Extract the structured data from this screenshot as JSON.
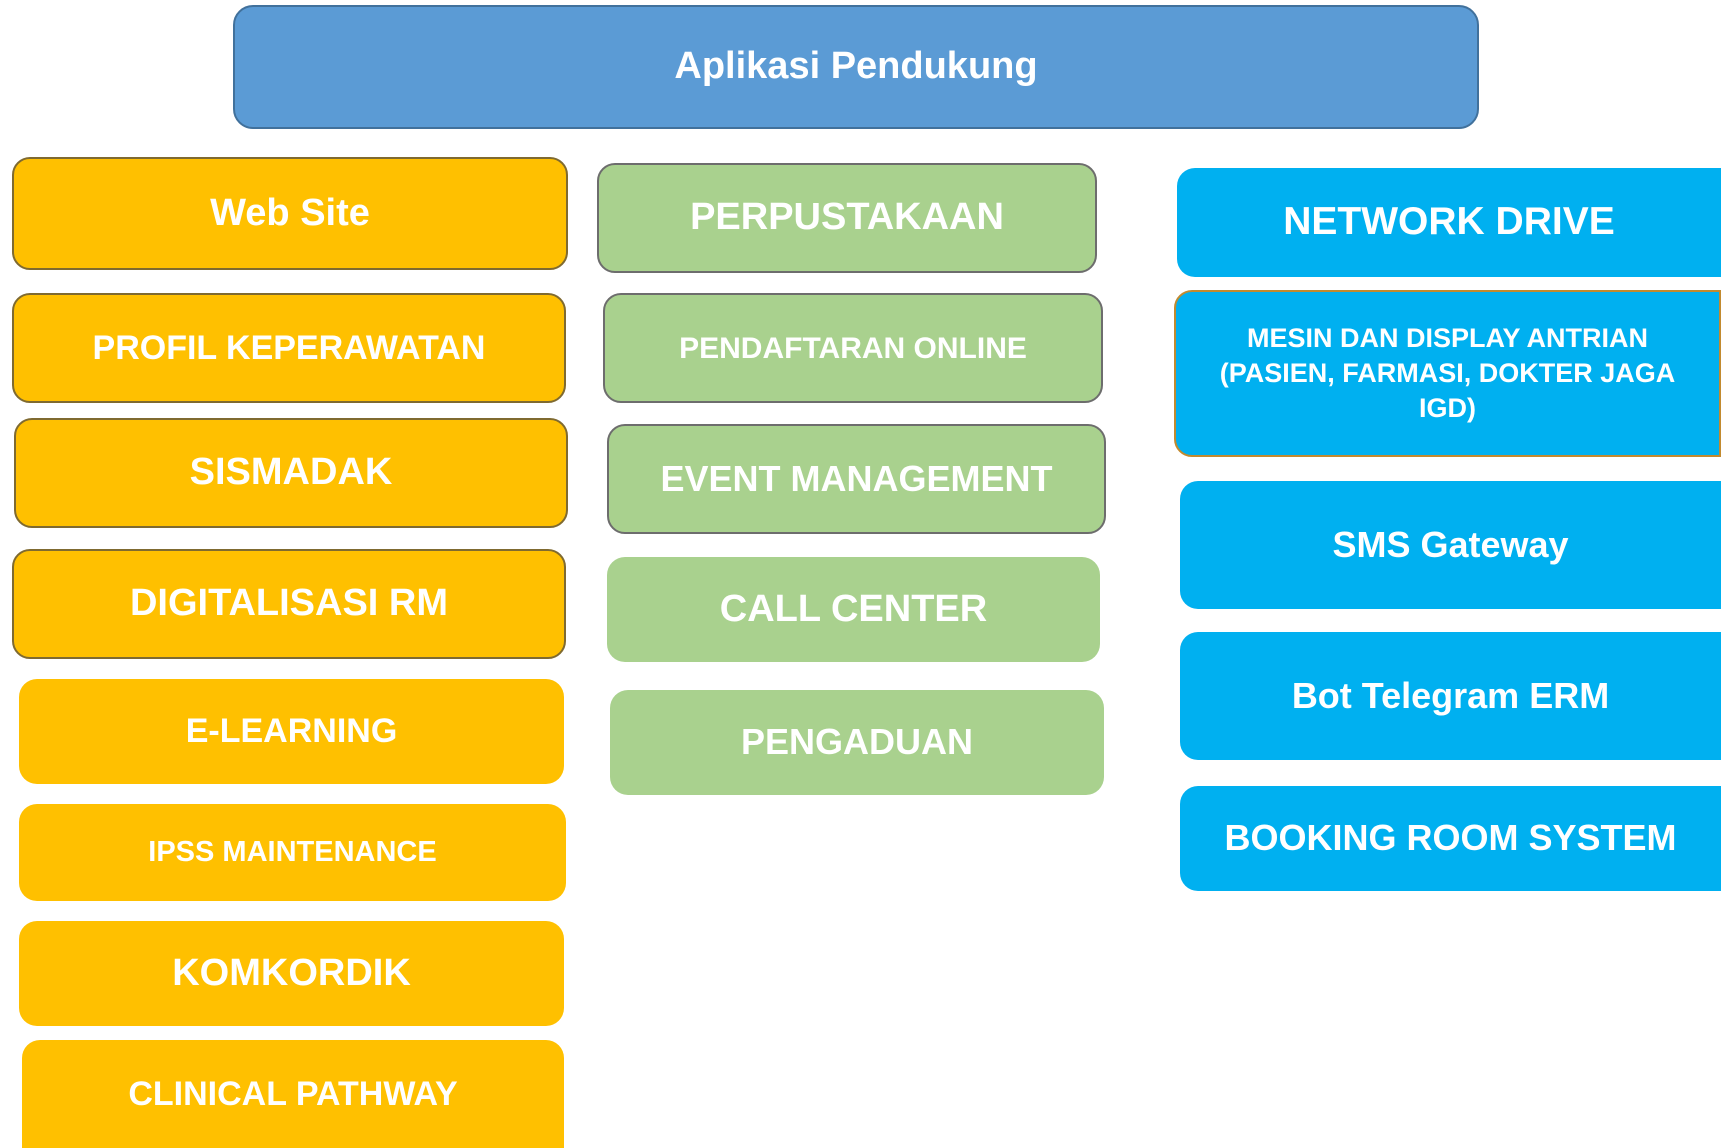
{
  "header": {
    "title": "Aplikasi Pendukung"
  },
  "columns": {
    "left": {
      "color": "#ffc000",
      "items": [
        "Web Site",
        "PROFIL KEPERAWATAN",
        "SISMADAK",
        "DIGITALISASI RM",
        "E-LEARNING",
        "IPSS MAINTENANCE",
        "KOMKORDIK",
        "CLINICAL PATHWAY"
      ]
    },
    "middle": {
      "color": "#a9d18e",
      "items": [
        "PERPUSTAKAAN",
        "PENDAFTARAN ONLINE",
        "EVENT MANAGEMENT",
        "CALL CENTER",
        "PENGADUAN"
      ]
    },
    "right": {
      "color": "#00b0f0",
      "items": [
        "NETWORK DRIVE",
        "MESIN DAN DISPLAY ANTRIAN (PASIEN, FARMASI, DOKTER JAGA IGD)",
        "SMS Gateway",
        "Bot Telegram ERM",
        "BOOKING ROOM SYSTEM"
      ]
    }
  }
}
